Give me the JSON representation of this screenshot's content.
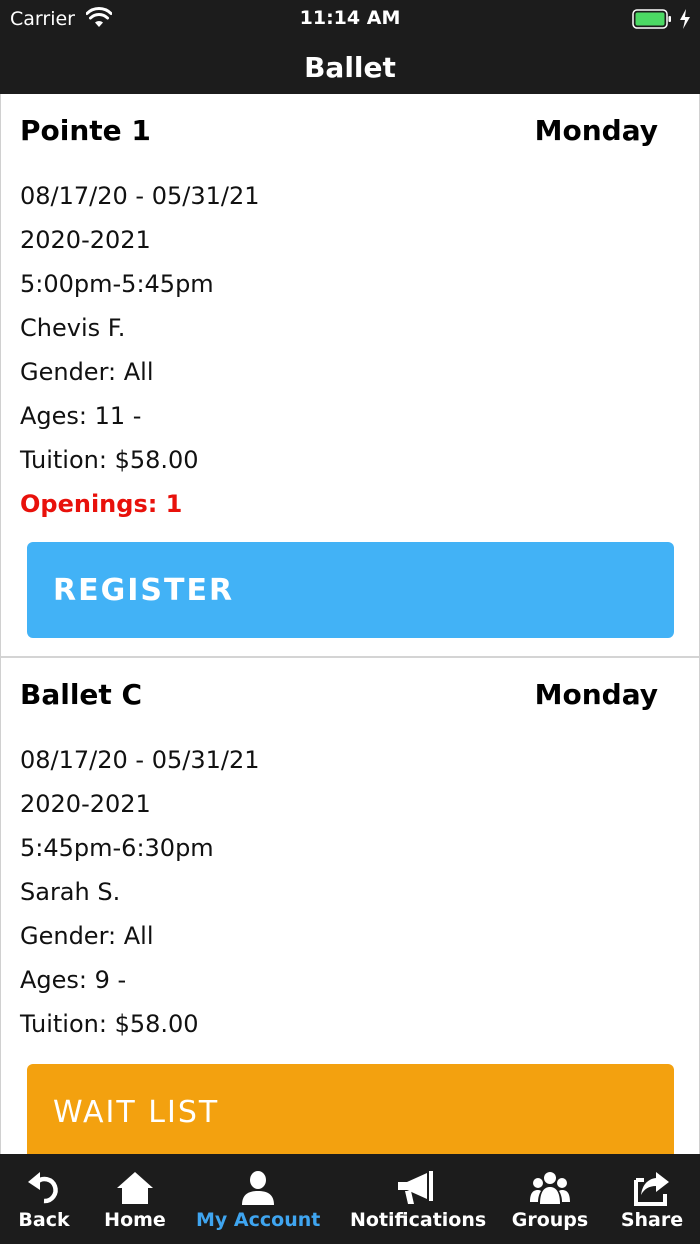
{
  "status_bar": {
    "carrier": "Carrier",
    "time": "11:14 AM",
    "battery_color": "#4cd964"
  },
  "nav": {
    "title": "Ballet"
  },
  "classes": [
    {
      "name": "Pointe 1",
      "day": "Monday",
      "dates": "08/17/20 - 05/31/21",
      "season": "2020-2021",
      "time": "5:00pm-5:45pm",
      "instructor": "Chevis F.",
      "gender": "Gender: All",
      "ages": "Ages: 11 -",
      "tuition": "Tuition: $58.00",
      "openings": "Openings: 1",
      "button_label": "REGISTER"
    },
    {
      "name": "Ballet C",
      "day": "Monday",
      "dates": "08/17/20 - 05/31/21",
      "season": "2020-2021",
      "time": "5:45pm-6:30pm",
      "instructor": "Sarah S.",
      "gender": "Gender: All",
      "ages": "Ages: 9 -",
      "tuition": "Tuition: $58.00",
      "button_label": "WAIT LIST"
    }
  ],
  "tabs": [
    {
      "label": "Back",
      "icon": "back-icon"
    },
    {
      "label": "Home",
      "icon": "home-icon"
    },
    {
      "label": "My Account",
      "icon": "user-icon",
      "active": true
    },
    {
      "label": "Notifications",
      "icon": "megaphone-icon"
    },
    {
      "label": "Groups",
      "icon": "groups-icon"
    },
    {
      "label": "Share",
      "icon": "share-icon"
    }
  ],
  "colors": {
    "bar_background": "#1c1c1c",
    "register_button": "#42b2f6",
    "waitlist_button": "#f3a10f",
    "openings_text": "#e8110b",
    "active_tab": "#3fa5f0"
  }
}
